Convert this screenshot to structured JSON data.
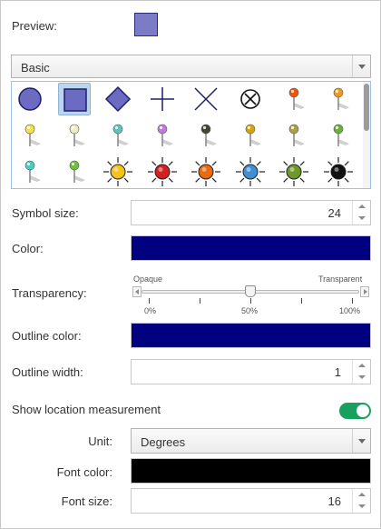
{
  "preview": {
    "label": "Preview:",
    "swatch_color": "#7c7cc6"
  },
  "category": {
    "value": "Basic"
  },
  "gallery": {
    "symbols": [
      "circle-icon",
      "square-icon",
      "diamond-icon",
      "cross-icon",
      "x-icon",
      "circle-x-icon",
      "pin-orange-icon",
      "pin-orange-light-icon",
      "pin-yellow-icon",
      "pin-cream-icon",
      "pin-teal-yellow-icon",
      "pin-purple-icon",
      "pin-dark-icon",
      "pin-gold-icon",
      "pin-olive-icon",
      "pin-green-icon",
      "pin-cyan-icon",
      "pin-lime-icon",
      "sun-yellow-icon",
      "sun-red-icon",
      "sun-orange-icon",
      "sun-blue-icon",
      "sun-green-icon",
      "sun-black-icon"
    ],
    "selected_index": 1
  },
  "symbol_size": {
    "label": "Symbol size:",
    "value": "24"
  },
  "color": {
    "label": "Color:",
    "value": "#000080"
  },
  "transparency": {
    "label": "Transparency:",
    "left_caption": "Opaque",
    "right_caption": "Transparent",
    "ticks": [
      "0%",
      "50%",
      "100%"
    ],
    "value_percent": 50
  },
  "outline_color": {
    "label": "Outline color:",
    "value": "#000080"
  },
  "outline_width": {
    "label": "Outline width:",
    "value": "1"
  },
  "location": {
    "label": "Show location measurement",
    "enabled": true,
    "toggle_color": "#1aa05e",
    "unit_label": "Unit:",
    "unit_value": "Degrees",
    "font_color_label": "Font color:",
    "font_color_value": "#000000",
    "font_size_label": "Font size:",
    "font_size_value": "16"
  }
}
